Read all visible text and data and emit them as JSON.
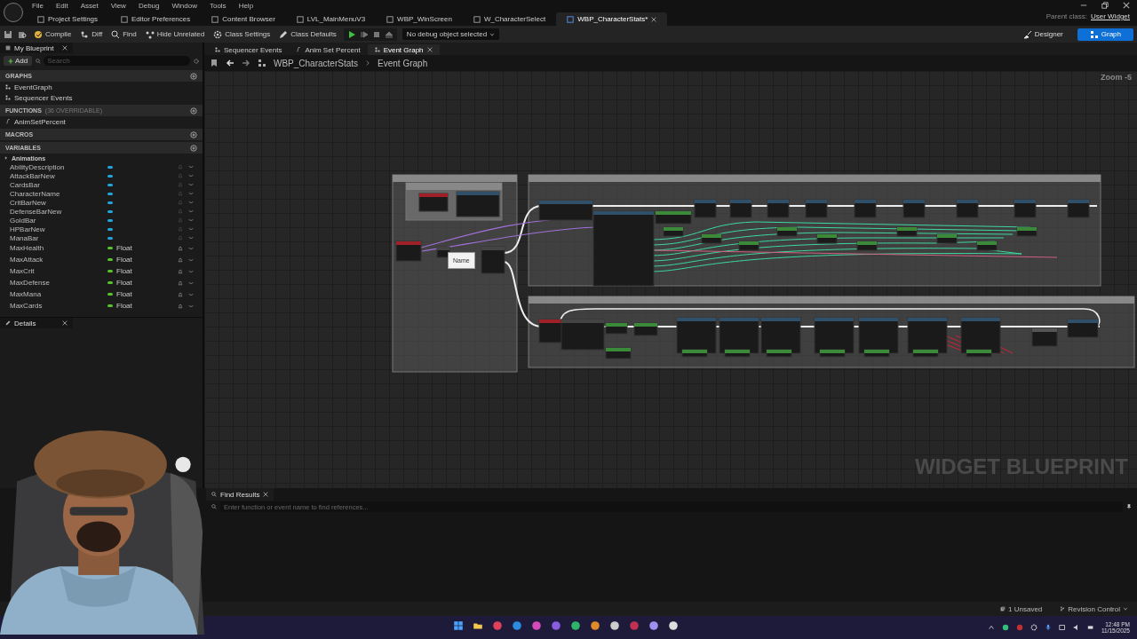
{
  "menu": [
    "File",
    "Edit",
    "Asset",
    "View",
    "Debug",
    "Window",
    "Tools",
    "Help"
  ],
  "asset_tabs": [
    {
      "label": "Project Settings",
      "selected": false
    },
    {
      "label": "Editor Preferences",
      "selected": false
    },
    {
      "label": "Content Browser",
      "selected": false
    },
    {
      "label": "LVL_MainMenuV3",
      "selected": false
    },
    {
      "label": "WBP_WinScreen",
      "selected": false
    },
    {
      "label": "W_CharacterSelect",
      "selected": false
    },
    {
      "label": "WBP_CharacterStats*",
      "selected": true
    }
  ],
  "parent_class": {
    "label": "Parent class:",
    "value": "User Widget"
  },
  "toolbar": {
    "buttons": [
      "Compile",
      "Diff",
      "Find",
      "Hide Unrelated",
      "Class Settings",
      "Class Defaults"
    ],
    "debug_object": "No debug object selected",
    "modes": [
      {
        "label": "Designer",
        "selected": false
      },
      {
        "label": "Graph",
        "selected": true
      }
    ]
  },
  "my_blueprint": {
    "title": "My Blueprint",
    "add": "Add",
    "search": {
      "placeholder": "Search"
    },
    "sections": [
      {
        "title": "GRAPHS",
        "items": [
          "EventGraph",
          "Sequencer Events"
        ]
      },
      {
        "title": "FUNCTIONS",
        "note": "(36 OVERRIDABLE)",
        "items": [
          "AnimSetPercent"
        ]
      },
      {
        "title": "MACROS"
      },
      {
        "title": "VARIABLES",
        "category": "Animations",
        "variables": [
          {
            "name": "AbilityDescription",
            "color": "#1fa6e0"
          },
          {
            "name": "AttackBarNew",
            "color": "#1fa6e0"
          },
          {
            "name": "CardsBar",
            "color": "#1fa6e0"
          },
          {
            "name": "CharacterName",
            "color": "#1fa6e0"
          },
          {
            "name": "CritBarNew",
            "color": "#1fa6e0"
          },
          {
            "name": "DefenseBarNew",
            "color": "#1fa6e0"
          },
          {
            "name": "GoldBar",
            "color": "#1fa6e0"
          },
          {
            "name": "HPBarNew",
            "color": "#1fa6e0"
          },
          {
            "name": "ManaBar",
            "color": "#1fa6e0"
          },
          {
            "name": "MaxHealth",
            "color": "#56c42a",
            "type": "Float"
          },
          {
            "name": "MaxAttack",
            "color": "#56c42a",
            "type": "Float"
          },
          {
            "name": "MaxCrit",
            "color": "#56c42a",
            "type": "Float"
          },
          {
            "name": "MaxDefense",
            "color": "#56c42a",
            "type": "Float"
          },
          {
            "name": "MaxMana",
            "color": "#56c42a",
            "type": "Float"
          },
          {
            "name": "MaxCards",
            "color": "#56c42a",
            "type": "Float"
          }
        ]
      }
    ]
  },
  "details": {
    "title": "Details"
  },
  "graph_tabs": [
    {
      "label": "Sequencer Events",
      "selected": false
    },
    {
      "label": "Anim Set Percent",
      "selected": false
    },
    {
      "label": "Event Graph",
      "selected": true
    }
  ],
  "breadcrumb": [
    "WBP_CharacterStats",
    "Event Graph"
  ],
  "graph": {
    "zoom": "Zoom -5",
    "tooltip": "Name",
    "watermark": "WIDGET BLUEPRINT"
  },
  "find_results": {
    "title": "Find Results",
    "placeholder": "Enter function or event name to find references..."
  },
  "status_bar": {
    "unsaved": "1 Unsaved",
    "revision_control": "Revision Control"
  },
  "taskbar": {
    "time": "12:48 PM",
    "date": "11/15/2025"
  },
  "webcam": {
    "kind": "picture"
  }
}
